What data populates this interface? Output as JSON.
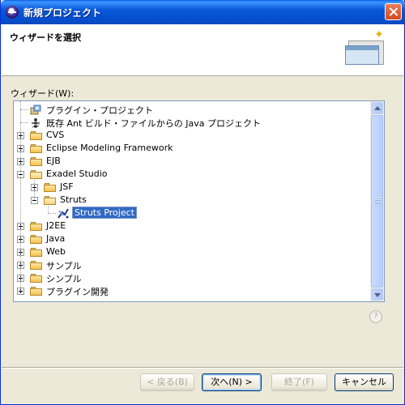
{
  "window": {
    "title": "新規プロジェクト"
  },
  "banner": {
    "title": "ウィザードを選択"
  },
  "tree": {
    "label": "ウィザード(W):",
    "items": [
      {
        "label": "プラグイン・プロジェクト",
        "icon": "plugin-project-icon",
        "depth": 1,
        "expander": "none"
      },
      {
        "label": "既存 Ant ビルド・ファイルからの Java プロジェクト",
        "icon": "ant-icon",
        "depth": 1,
        "expander": "none"
      },
      {
        "label": "CVS",
        "icon": "folder-icon",
        "depth": 1,
        "expander": "plus"
      },
      {
        "label": "Eclipse Modeling Framework",
        "icon": "folder-icon",
        "depth": 1,
        "expander": "plus"
      },
      {
        "label": "EJB",
        "icon": "folder-icon",
        "depth": 1,
        "expander": "plus"
      },
      {
        "label": "Exadel Studio",
        "icon": "folder-open-icon",
        "depth": 1,
        "expander": "minus"
      },
      {
        "label": "JSF",
        "icon": "folder-icon",
        "depth": 2,
        "expander": "plus"
      },
      {
        "label": "Struts",
        "icon": "folder-open-icon",
        "depth": 2,
        "expander": "minus"
      },
      {
        "label": "Struts Project",
        "icon": "struts-project-icon",
        "depth": 3,
        "expander": "none",
        "selected": true
      },
      {
        "label": "J2EE",
        "icon": "folder-icon",
        "depth": 1,
        "expander": "plus"
      },
      {
        "label": "Java",
        "icon": "folder-icon",
        "depth": 1,
        "expander": "plus"
      },
      {
        "label": "Web",
        "icon": "folder-icon",
        "depth": 1,
        "expander": "plus"
      },
      {
        "label": "サンプル",
        "icon": "folder-icon",
        "depth": 1,
        "expander": "plus"
      },
      {
        "label": "シンプル",
        "icon": "folder-icon",
        "depth": 1,
        "expander": "plus"
      },
      {
        "label": "プラグイン開発",
        "icon": "folder-icon",
        "depth": 1,
        "expander": "plus"
      }
    ]
  },
  "help": {
    "icon": "help-icon",
    "glyph": "?"
  },
  "buttons": {
    "back": "< 戻る(B)",
    "next": "次へ(N) >",
    "finish": "終了(F)",
    "cancel": "キャンセル"
  },
  "colors": {
    "selection": "#316ac5",
    "titlebar": "#0a58d8",
    "dialog_bg": "#ece9d8"
  }
}
